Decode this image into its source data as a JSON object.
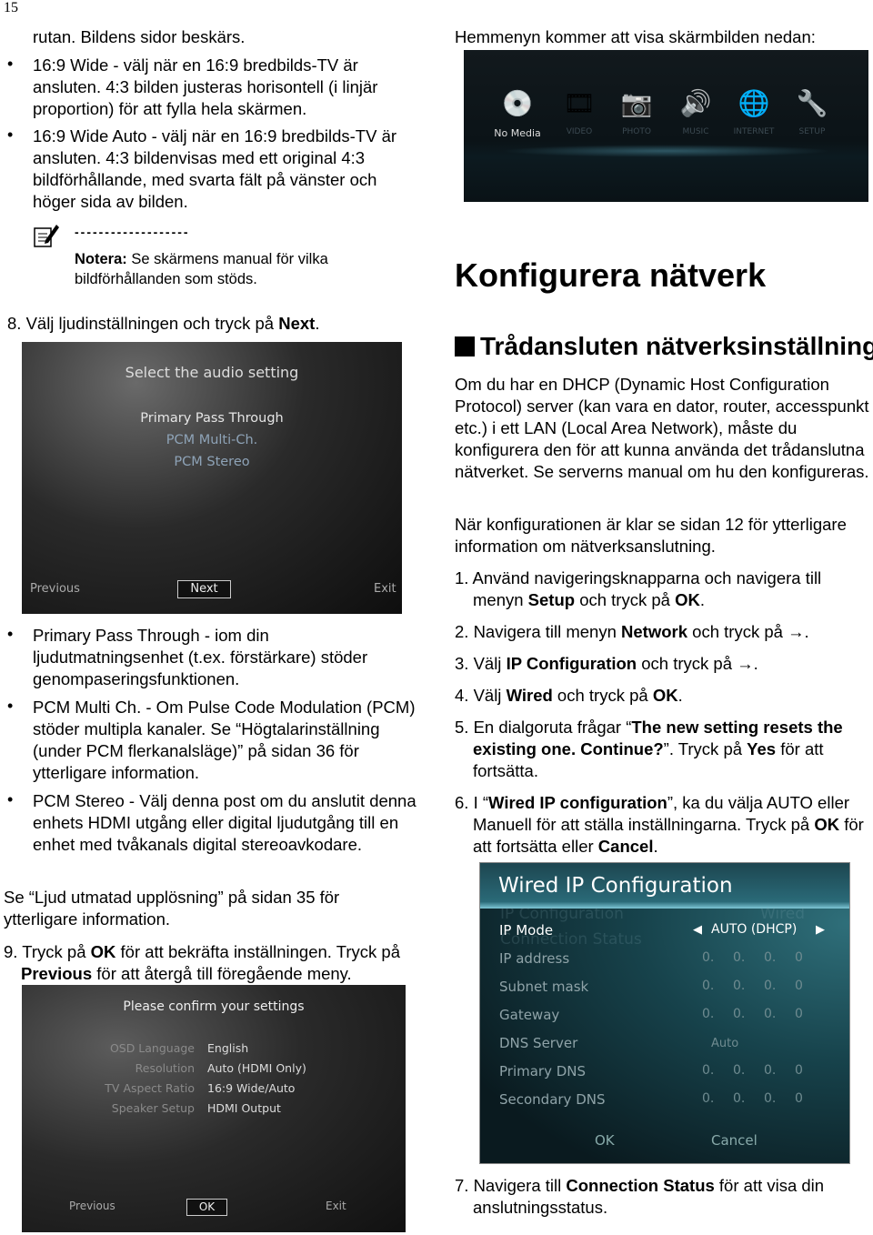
{
  "page_number": "15",
  "left": {
    "intro": [
      {
        "t": "rutan. Bildens sidor beskärs."
      }
    ],
    "bullets_top": [
      [
        {
          "t": "16:9 Wide - välj när en 16:9 bredbilds-TV är ansluten. 4:3 bilden justeras horisontell (i linjär proportion) för att fylla hela skärmen."
        }
      ],
      [
        {
          "t": "16:9 Wide Auto - välj när en 16:9 bredbilds-TV är ansluten. 4:3 bildenvisas med ett original 4:3 bildförhållande, med svarta fält på vänster och höger sida av bilden."
        }
      ]
    ],
    "note": {
      "icon": "note-pencil-icon",
      "dashes": "-------------------",
      "segments": [
        {
          "t": "Notera:",
          "b": true
        },
        {
          "t": " Se skärmens manual för vilka bildförhållanden som stöds."
        }
      ]
    },
    "step8": [
      {
        "t": "8. Välj ljudinställningen och tryck på "
      },
      {
        "t": "Next",
        "b": true
      },
      {
        "t": "."
      }
    ],
    "audio_screen": {
      "title": "Select the audio setting",
      "options": [
        "Primary Pass Through",
        "PCM Multi-Ch.",
        "PCM Stereo"
      ],
      "previous": "Previous",
      "next": "Next",
      "exit": "Exit"
    },
    "bullets_bottom": [
      [
        {
          "t": "Primary Pass Through - iom din ljudutmatningsenhet (t.ex. förstärkare) stöder genompaseringsfunktionen."
        }
      ],
      [
        {
          "t": "PCM Multi Ch. - Om Pulse Code Modulation (PCM) stöder multipla kanaler. Se “Högtalarinställning (under PCM flerkanalsläge)” på sidan 36 för ytterligare information."
        }
      ],
      [
        {
          "t": "PCM Stereo - Välj denna post om du anslutit denna enhets HDMI utgång eller digital ljudutgång till en enhet med tvåkanals digital stereoavkodare."
        }
      ]
    ],
    "see_audio": [
      {
        "t": "Se “Ljud utmatad upplösning” på sidan 35 för ytterligare information."
      }
    ],
    "step9": [
      {
        "t": "9. Tryck på "
      },
      {
        "t": "OK",
        "b": true
      },
      {
        "t": " för att bekräfta inställningen. Tryck på "
      },
      {
        "t": "Previous",
        "b": true
      },
      {
        "t": " för att återgå till föregående meny."
      }
    ],
    "confirm_screen": {
      "title": "Please confirm your settings",
      "rows": [
        {
          "label": "OSD Language",
          "value": "English"
        },
        {
          "label": "Resolution",
          "value": "Auto (HDMI Only)"
        },
        {
          "label": "TV Aspect Ratio",
          "value": "16:9 Wide/Auto"
        },
        {
          "label": "Speaker Setup",
          "value": "HDMI Output"
        }
      ],
      "previous": "Previous",
      "ok": "OK",
      "exit": "Exit"
    }
  },
  "right": {
    "home_intro": [
      {
        "t": "Hemmenyn kommer att visa skärmbilden nedan:"
      }
    ],
    "home_screen": {
      "items": [
        {
          "label": "No Media",
          "icon": "disc-icon",
          "active": true
        },
        {
          "label": "VIDEO",
          "icon": "film-reel-icon"
        },
        {
          "label": "PHOTO",
          "icon": "camera-icon"
        },
        {
          "label": "MUSIC",
          "icon": "speakers-icon"
        },
        {
          "label": "INTERNET",
          "icon": "globe-router-icon"
        },
        {
          "label": "SETUP",
          "icon": "wrench-icon"
        }
      ]
    },
    "heading": "Konfigurera nätverk",
    "subheading": "Trådansluten nätverksinställning",
    "para1": [
      {
        "t": "Om du har en DHCP (Dynamic Host Configuration Protocol) server (kan vara en dator, router, accesspunkt etc.) i ett LAN (Local Area Network), måste du konfigurera den för att kunna använda det trådanslutna nätverket. Se serverns manual om hu den konfigureras."
      }
    ],
    "para2": [
      {
        "t": "När konfigurationen är klar se sidan 12 för ytterligare information om nätverksanslutning."
      }
    ],
    "steps": [
      [
        {
          "t": "1. Använd navigeringsknapparna och navigera till menyn "
        },
        {
          "t": "Setup",
          "b": true
        },
        {
          "t": " och tryck på "
        },
        {
          "t": "OK",
          "b": true
        },
        {
          "t": "."
        }
      ],
      [
        {
          "t": "2. Navigera till menyn "
        },
        {
          "t": "Network",
          "b": true
        },
        {
          "t": " och tryck på →."
        }
      ],
      [
        {
          "t": "3. Välj "
        },
        {
          "t": "IP Configuration",
          "b": true
        },
        {
          "t": " och tryck på →."
        }
      ],
      [
        {
          "t": "4. Välj "
        },
        {
          "t": "Wired",
          "b": true
        },
        {
          "t": " och tryck på "
        },
        {
          "t": "OK",
          "b": true
        },
        {
          "t": "."
        }
      ],
      [
        {
          "t": "5. En dialgoruta frågar “"
        },
        {
          "t": "The new setting resets the existing one. Continue?",
          "b": true
        },
        {
          "t": "”. Tryck på "
        },
        {
          "t": "Yes",
          "b": true
        },
        {
          "t": " för att fortsätta."
        }
      ],
      [
        {
          "t": "6. I “"
        },
        {
          "t": "Wired IP configuration",
          "b": true
        },
        {
          "t": "”, ka  du välja AUTO eller Manuell för att ställa inställningarna. Tryck på "
        },
        {
          "t": "OK",
          "b": true
        },
        {
          "t": " för att fortsätta eller "
        },
        {
          "t": "Cancel",
          "b": true
        },
        {
          "t": "."
        }
      ]
    ],
    "wired_screen": {
      "title": "Wired IP Configuration",
      "ghost": [
        "IP Configuration",
        "Connection Status",
        "Wired"
      ],
      "ip_mode_label": "IP Mode",
      "ip_mode_value": "AUTO (DHCP)",
      "rows": [
        {
          "label": "IP address",
          "octets": [
            "0.",
            "0.",
            "0.",
            "0"
          ]
        },
        {
          "label": "Subnet mask",
          "octets": [
            "0.",
            "0.",
            "0.",
            "0"
          ]
        },
        {
          "label": "Gateway",
          "octets": [
            "0.",
            "0.",
            "0.",
            "0"
          ]
        },
        {
          "label": "DNS Server",
          "value": "Auto"
        },
        {
          "label": "Primary DNS",
          "octets": [
            "0.",
            "0.",
            "0.",
            "0"
          ]
        },
        {
          "label": "Secondary DNS",
          "octets": [
            "0.",
            "0.",
            "0.",
            "0"
          ]
        }
      ],
      "ok": "OK",
      "cancel": "Cancel"
    },
    "step7": [
      {
        "t": "7. Navigera till "
      },
      {
        "t": "Connection Status",
        "b": true
      },
      {
        "t": " för att visa din anslutningsstatus."
      }
    ]
  }
}
